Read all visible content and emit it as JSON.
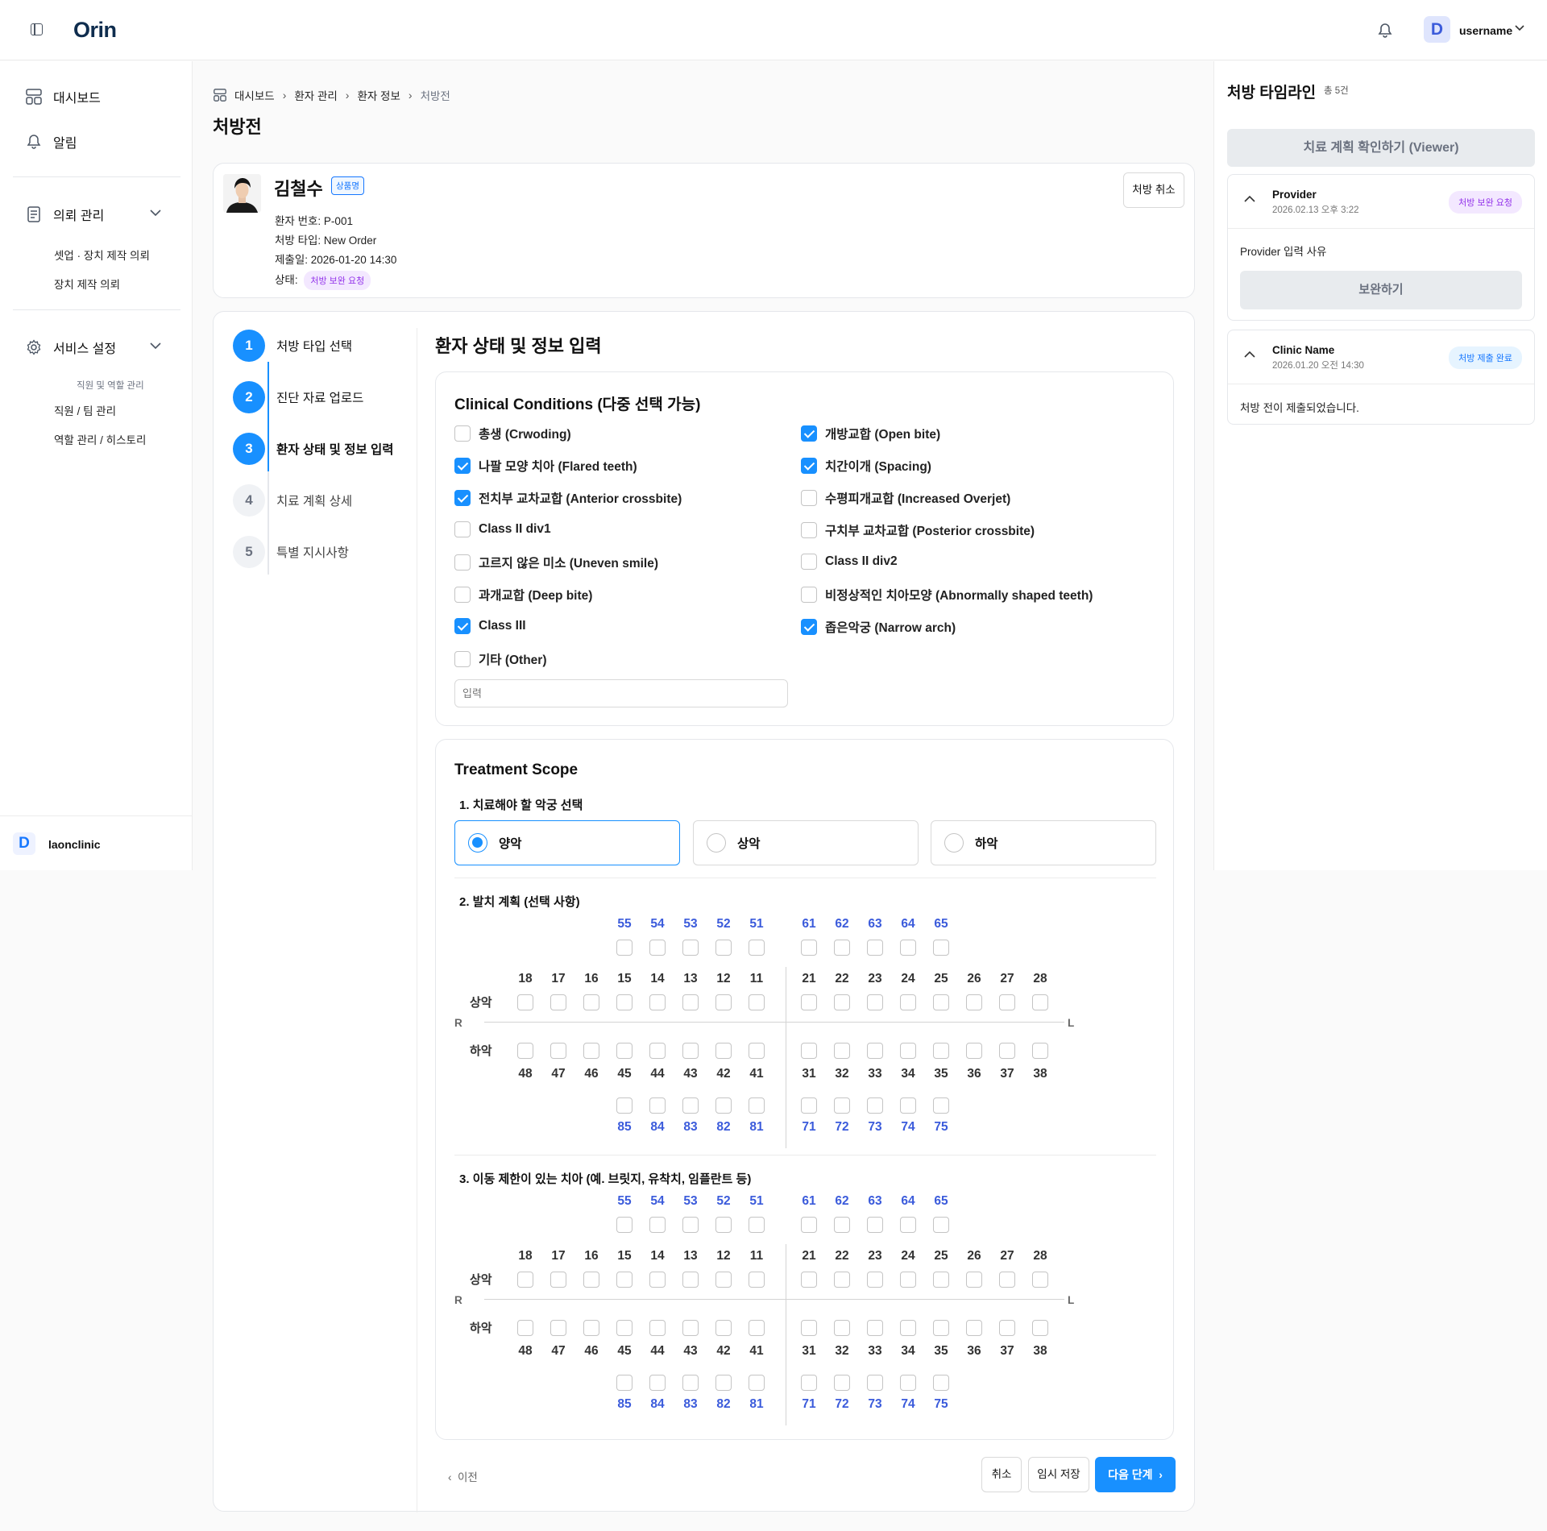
{
  "header": {
    "logo": "Orin",
    "avatar_letter": "D",
    "username": "username"
  },
  "sidebar": {
    "dashboard": "대시보드",
    "alerts": "알림",
    "request_mgmt": "의뢰 관리",
    "request_items": [
      "셋업 · 장치 제작 의뢰",
      "장치 제작 의뢰"
    ],
    "service_settings": "서비스 설정",
    "service_caption": "직원 및 역할 관리",
    "service_items": [
      "직원 / 팀 관리",
      "역할 관리 / 히스토리"
    ],
    "footer_letter": "D",
    "footer_name": "laonclinic"
  },
  "breadcrumb": [
    "대시보드",
    "환자 관리",
    "환자 정보",
    "처방전"
  ],
  "page_title": "처방전",
  "patient": {
    "name": "김철수",
    "tag": "상품명",
    "number": "환자 번호: P-001",
    "type": "처방 타입: New Order",
    "submitted": "제출일: 2026-01-20 14:30",
    "status_label": "상태:",
    "status": "처방 보완 요청",
    "cancel_button": "처방 취소"
  },
  "steps": [
    {
      "num": "1",
      "label": "처방 타입 선택",
      "active": true
    },
    {
      "num": "2",
      "label": "진단 자료 업로드",
      "active": true
    },
    {
      "num": "3",
      "label": "환자 상태 및 정보 입력",
      "active": true
    },
    {
      "num": "4",
      "label": "치료 계획 상세",
      "active": false
    },
    {
      "num": "5",
      "label": "특별 지시사항",
      "active": false
    }
  ],
  "section_title": "환자 상태 및 정보 입력",
  "clinical": {
    "title": "Clinical Conditions (다중 선택 가능)",
    "left": [
      {
        "label": "총생 (Crwoding)",
        "checked": false
      },
      {
        "label": "나팔 모양 치아 (Flared teeth)",
        "checked": true
      },
      {
        "label": "전치부 교차교합 (Anterior crossbite)",
        "checked": true
      },
      {
        "label": "Class II div1",
        "checked": false
      },
      {
        "label": "고르지 않은 미소 (Uneven smile)",
        "checked": false
      },
      {
        "label": "과개교합 (Deep bite)",
        "checked": false
      },
      {
        "label": "Class III",
        "checked": true
      },
      {
        "label": "기타 (Other)",
        "checked": false
      }
    ],
    "right": [
      {
        "label": "개방교합 (Open bite)",
        "checked": true
      },
      {
        "label": "치간이개 (Spacing)",
        "checked": true
      },
      {
        "label": "수평피개교합 (Increased Overjet)",
        "checked": false
      },
      {
        "label": "구치부 교차교합 (Posterior crossbite)",
        "checked": false
      },
      {
        "label": "Class II div2",
        "checked": false
      },
      {
        "label": "비정상적인 치아모양 (Abnormally shaped teeth)",
        "checked": false
      },
      {
        "label": "좁은악궁 (Narrow arch)",
        "checked": true
      }
    ],
    "other_placeholder": "입력"
  },
  "treatment": {
    "title": "Treatment Scope",
    "q1": "1. 치료해야 할 악궁 선택",
    "arch_options": [
      {
        "label": "양악",
        "selected": true
      },
      {
        "label": "상악",
        "selected": false
      },
      {
        "label": "하악",
        "selected": false
      }
    ],
    "q2": "2. 발치 계획 (선택 사항)",
    "q3": "3. 이동 제한이 있는 치아 (예. 브릿지, 유착치, 임플란트 등)",
    "upper_label": "상악",
    "lower_label": "하악",
    "right_label": "R",
    "left_label": "L",
    "upper_primary_right": [
      "55",
      "54",
      "53",
      "52",
      "51"
    ],
    "upper_primary_left": [
      "61",
      "62",
      "63",
      "64",
      "65"
    ],
    "upper_right": [
      "18",
      "17",
      "16",
      "15",
      "14",
      "13",
      "12",
      "11"
    ],
    "upper_left": [
      "21",
      "22",
      "23",
      "24",
      "25",
      "26",
      "27",
      "28"
    ],
    "lower_right": [
      "48",
      "47",
      "46",
      "45",
      "44",
      "43",
      "42",
      "41"
    ],
    "lower_left": [
      "31",
      "32",
      "33",
      "34",
      "35",
      "36",
      "37",
      "38"
    ],
    "lower_primary_right": [
      "85",
      "84",
      "83",
      "82",
      "81"
    ],
    "lower_primary_left": [
      "71",
      "72",
      "73",
      "74",
      "75"
    ]
  },
  "footer": {
    "prev": "이전",
    "cancel": "취소",
    "save": "임시 저장",
    "next": "다음 단계"
  },
  "timeline": {
    "title": "처방 타임라인",
    "count": "총 5건",
    "viewer_button": "치료 계획 확인하기 (Viewer)",
    "entries": [
      {
        "name": "Provider",
        "date": "2026.02.13 오후 3:22",
        "badge": "처방 보완 요청",
        "body": "Provider 입력 사유",
        "action": "보완하기"
      },
      {
        "name": "Clinic Name",
        "date": "2026.01.20 오전 14:30",
        "badge": "처방 제출 완료",
        "body": "처방 전이 제출되었습니다."
      }
    ]
  },
  "colors": {
    "primary": "#1890ff",
    "brand": "#0f2d4e",
    "primary_tooth": "#3b5bdb",
    "request_badge": "#9333ea",
    "done_badge": "#1677ff"
  }
}
